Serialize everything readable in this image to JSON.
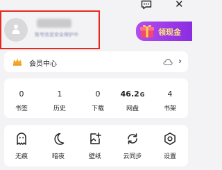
{
  "header": {
    "message_icon": "message-icon",
    "close_icon": "close-icon",
    "close_glyph": "✕"
  },
  "profile": {
    "avatar_icon": "default-avatar-icon",
    "privacy_note": "账号信息安全保护中"
  },
  "cash_button": {
    "label": "领现金",
    "icon": "gift-icon"
  },
  "member": {
    "label": "会员中心",
    "icon": "crown-icon",
    "status_icon": "cloud-icon",
    "arrow": "›"
  },
  "stats": [
    {
      "value": "0",
      "unit": "",
      "label": "书签"
    },
    {
      "value": "1",
      "unit": "",
      "label": "历史"
    },
    {
      "value": "0",
      "unit": "",
      "label": "下载"
    },
    {
      "value": "46.2",
      "unit": "G",
      "label": "网盘"
    },
    {
      "value": "4",
      "unit": "",
      "label": "书架"
    }
  ],
  "tools": [
    {
      "label": "无痕",
      "icon": "ghost-icon"
    },
    {
      "label": "暗夜",
      "icon": "moon-icon"
    },
    {
      "label": "壁纸",
      "icon": "wallpaper-icon"
    },
    {
      "label": "云同步",
      "icon": "sync-icon"
    },
    {
      "label": "设置",
      "icon": "gear-icon"
    }
  ],
  "colors": {
    "highlight_border": "#e8271d",
    "cash_button": "#a040ee",
    "cash_text": "#ffe77a",
    "member_icon": "#f5a623"
  }
}
